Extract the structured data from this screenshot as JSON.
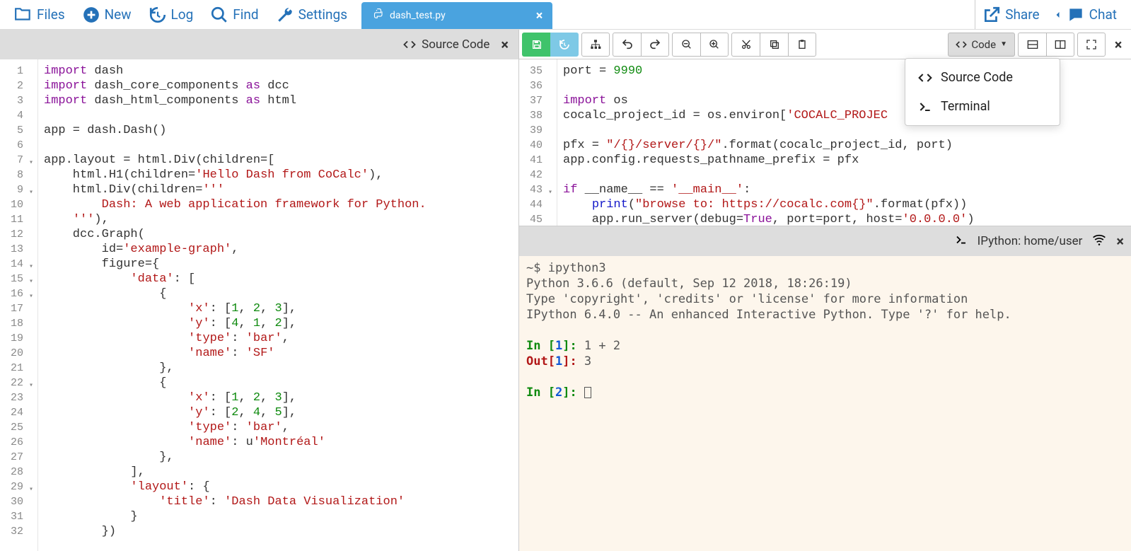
{
  "topbar": {
    "files": "Files",
    "new": "New",
    "log": "Log",
    "find": "Find",
    "settings": "Settings",
    "share": "Share",
    "chat": "Chat"
  },
  "tab": {
    "filename": "dash_test.py"
  },
  "left_pane": {
    "title": "Source Code",
    "line_numbers": [
      "1",
      "2",
      "3",
      "4",
      "5",
      "6",
      "7",
      "8",
      "9",
      "10",
      "11",
      "12",
      "13",
      "14",
      "15",
      "16",
      "17",
      "18",
      "19",
      "20",
      "21",
      "22",
      "23",
      "24",
      "25",
      "26",
      "27",
      "28",
      "29",
      "30",
      "31",
      "32"
    ],
    "fold_lines": [
      "7",
      "9",
      "14",
      "15",
      "16",
      "22",
      "29"
    ],
    "lines": [
      [
        {
          "c": "kw",
          "t": "import"
        },
        {
          "c": "op",
          "t": " dash"
        }
      ],
      [
        {
          "c": "kw",
          "t": "import"
        },
        {
          "c": "op",
          "t": " dash_core_components "
        },
        {
          "c": "kw",
          "t": "as"
        },
        {
          "c": "op",
          "t": " dcc"
        }
      ],
      [
        {
          "c": "kw",
          "t": "import"
        },
        {
          "c": "op",
          "t": " dash_html_components "
        },
        {
          "c": "kw",
          "t": "as"
        },
        {
          "c": "op",
          "t": " html"
        }
      ],
      [
        {
          "c": "op",
          "t": ""
        }
      ],
      [
        {
          "c": "op",
          "t": "app = dash.Dash()"
        }
      ],
      [
        {
          "c": "op",
          "t": ""
        }
      ],
      [
        {
          "c": "op",
          "t": "app.layout = html.Div(children=["
        }
      ],
      [
        {
          "c": "op",
          "t": "    html.H1(children="
        },
        {
          "c": "str",
          "t": "'Hello Dash from CoCalc'"
        },
        {
          "c": "op",
          "t": "),"
        }
      ],
      [
        {
          "c": "op",
          "t": "    html.Div(children="
        },
        {
          "c": "str",
          "t": "'''"
        }
      ],
      [
        {
          "c": "str",
          "t": "        Dash: A web application framework for Python."
        }
      ],
      [
        {
          "c": "op",
          "t": "    "
        },
        {
          "c": "str",
          "t": "'''"
        },
        {
          "c": "op",
          "t": "),"
        }
      ],
      [
        {
          "c": "op",
          "t": "    dcc.Graph("
        }
      ],
      [
        {
          "c": "op",
          "t": "        id="
        },
        {
          "c": "str",
          "t": "'example-graph'"
        },
        {
          "c": "op",
          "t": ","
        }
      ],
      [
        {
          "c": "op",
          "t": "        figure={"
        }
      ],
      [
        {
          "c": "op",
          "t": "            "
        },
        {
          "c": "str",
          "t": "'data'"
        },
        {
          "c": "op",
          "t": ": ["
        }
      ],
      [
        {
          "c": "op",
          "t": "                {"
        }
      ],
      [
        {
          "c": "op",
          "t": "                    "
        },
        {
          "c": "str",
          "t": "'x'"
        },
        {
          "c": "op",
          "t": ": ["
        },
        {
          "c": "num",
          "t": "1"
        },
        {
          "c": "op",
          "t": ", "
        },
        {
          "c": "num",
          "t": "2"
        },
        {
          "c": "op",
          "t": ", "
        },
        {
          "c": "num",
          "t": "3"
        },
        {
          "c": "op",
          "t": "],"
        }
      ],
      [
        {
          "c": "op",
          "t": "                    "
        },
        {
          "c": "str",
          "t": "'y'"
        },
        {
          "c": "op",
          "t": ": ["
        },
        {
          "c": "num",
          "t": "4"
        },
        {
          "c": "op",
          "t": ", "
        },
        {
          "c": "num",
          "t": "1"
        },
        {
          "c": "op",
          "t": ", "
        },
        {
          "c": "num",
          "t": "2"
        },
        {
          "c": "op",
          "t": "],"
        }
      ],
      [
        {
          "c": "op",
          "t": "                    "
        },
        {
          "c": "str",
          "t": "'type'"
        },
        {
          "c": "op",
          "t": ": "
        },
        {
          "c": "str",
          "t": "'bar'"
        },
        {
          "c": "op",
          "t": ","
        }
      ],
      [
        {
          "c": "op",
          "t": "                    "
        },
        {
          "c": "str",
          "t": "'name'"
        },
        {
          "c": "op",
          "t": ": "
        },
        {
          "c": "str",
          "t": "'SF'"
        }
      ],
      [
        {
          "c": "op",
          "t": "                },"
        }
      ],
      [
        {
          "c": "op",
          "t": "                {"
        }
      ],
      [
        {
          "c": "op",
          "t": "                    "
        },
        {
          "c": "str",
          "t": "'x'"
        },
        {
          "c": "op",
          "t": ": ["
        },
        {
          "c": "num",
          "t": "1"
        },
        {
          "c": "op",
          "t": ", "
        },
        {
          "c": "num",
          "t": "2"
        },
        {
          "c": "op",
          "t": ", "
        },
        {
          "c": "num",
          "t": "3"
        },
        {
          "c": "op",
          "t": "],"
        }
      ],
      [
        {
          "c": "op",
          "t": "                    "
        },
        {
          "c": "str",
          "t": "'y'"
        },
        {
          "c": "op",
          "t": ": ["
        },
        {
          "c": "num",
          "t": "2"
        },
        {
          "c": "op",
          "t": ", "
        },
        {
          "c": "num",
          "t": "4"
        },
        {
          "c": "op",
          "t": ", "
        },
        {
          "c": "num",
          "t": "5"
        },
        {
          "c": "op",
          "t": "],"
        }
      ],
      [
        {
          "c": "op",
          "t": "                    "
        },
        {
          "c": "str",
          "t": "'type'"
        },
        {
          "c": "op",
          "t": ": "
        },
        {
          "c": "str",
          "t": "'bar'"
        },
        {
          "c": "op",
          "t": ","
        }
      ],
      [
        {
          "c": "op",
          "t": "                    "
        },
        {
          "c": "str",
          "t": "'name'"
        },
        {
          "c": "op",
          "t": ": u"
        },
        {
          "c": "str",
          "t": "'Montréal'"
        }
      ],
      [
        {
          "c": "op",
          "t": "                },"
        }
      ],
      [
        {
          "c": "op",
          "t": "            ],"
        }
      ],
      [
        {
          "c": "op",
          "t": "            "
        },
        {
          "c": "str",
          "t": "'layout'"
        },
        {
          "c": "op",
          "t": ": {"
        }
      ],
      [
        {
          "c": "op",
          "t": "                "
        },
        {
          "c": "str",
          "t": "'title'"
        },
        {
          "c": "op",
          "t": ": "
        },
        {
          "c": "str",
          "t": "'Dash Data Visualization'"
        }
      ],
      [
        {
          "c": "op",
          "t": "            }"
        }
      ],
      [
        {
          "c": "op",
          "t": "        })"
        }
      ]
    ]
  },
  "right_editor": {
    "line_numbers": [
      "35",
      "36",
      "37",
      "38",
      "39",
      "40",
      "41",
      "42",
      "43",
      "44",
      "45"
    ],
    "fold_lines": [
      "43"
    ],
    "lines": [
      [
        {
          "c": "op",
          "t": "port = "
        },
        {
          "c": "num",
          "t": "9990"
        }
      ],
      [
        {
          "c": "op",
          "t": ""
        }
      ],
      [
        {
          "c": "kw",
          "t": "import"
        },
        {
          "c": "op",
          "t": " os"
        }
      ],
      [
        {
          "c": "op",
          "t": "cocalc_project_id = os.environ["
        },
        {
          "c": "str",
          "t": "'COCALC_PROJEC"
        }
      ],
      [
        {
          "c": "op",
          "t": ""
        }
      ],
      [
        {
          "c": "op",
          "t": "pfx = "
        },
        {
          "c": "str",
          "t": "\"/{}/server/{}/\""
        },
        {
          "c": "op",
          "t": ".format(cocalc_project_id, port)"
        }
      ],
      [
        {
          "c": "op",
          "t": "app.config.requests_pathname_prefix = pfx"
        }
      ],
      [
        {
          "c": "op",
          "t": ""
        }
      ],
      [
        {
          "c": "kw",
          "t": "if"
        },
        {
          "c": "op",
          "t": " __name__ == "
        },
        {
          "c": "str",
          "t": "'__main__'"
        },
        {
          "c": "op",
          "t": ":"
        }
      ],
      [
        {
          "c": "op",
          "t": "    "
        },
        {
          "c": "def",
          "t": "print"
        },
        {
          "c": "op",
          "t": "("
        },
        {
          "c": "str",
          "t": "\"browse to: https://cocalc.com{}\""
        },
        {
          "c": "op",
          "t": ".format(pfx))"
        }
      ],
      [
        {
          "c": "op",
          "t": "    app.run_server(debug="
        },
        {
          "c": "kw",
          "t": "True"
        },
        {
          "c": "op",
          "t": ", port=port, host="
        },
        {
          "c": "str",
          "t": "'0.0.0.0'"
        },
        {
          "c": "op",
          "t": ")"
        }
      ]
    ]
  },
  "code_dropdown": {
    "button_label": "Code",
    "items": [
      "Source Code",
      "Terminal"
    ]
  },
  "terminal": {
    "title": "IPython: home/user",
    "banner1": "~$ ipython3",
    "banner2": "Python 3.6.6 (default, Sep 12 2018, 18:26:19)",
    "banner3": "Type 'copyright', 'credits' or 'license' for more information",
    "banner4": "IPython 6.4.0 -- An enhanced Interactive Python. Type '?' for help.",
    "in1_label_a": "In [",
    "in1_label_b": "1",
    "in1_label_c": "]: ",
    "in1_expr": "1 + 2",
    "out1_label_a": "Out[",
    "out1_label_b": "1",
    "out1_label_c": "]: ",
    "out1_val": "3",
    "in2_label_a": "In [",
    "in2_label_b": "2",
    "in2_label_c": "]: "
  }
}
